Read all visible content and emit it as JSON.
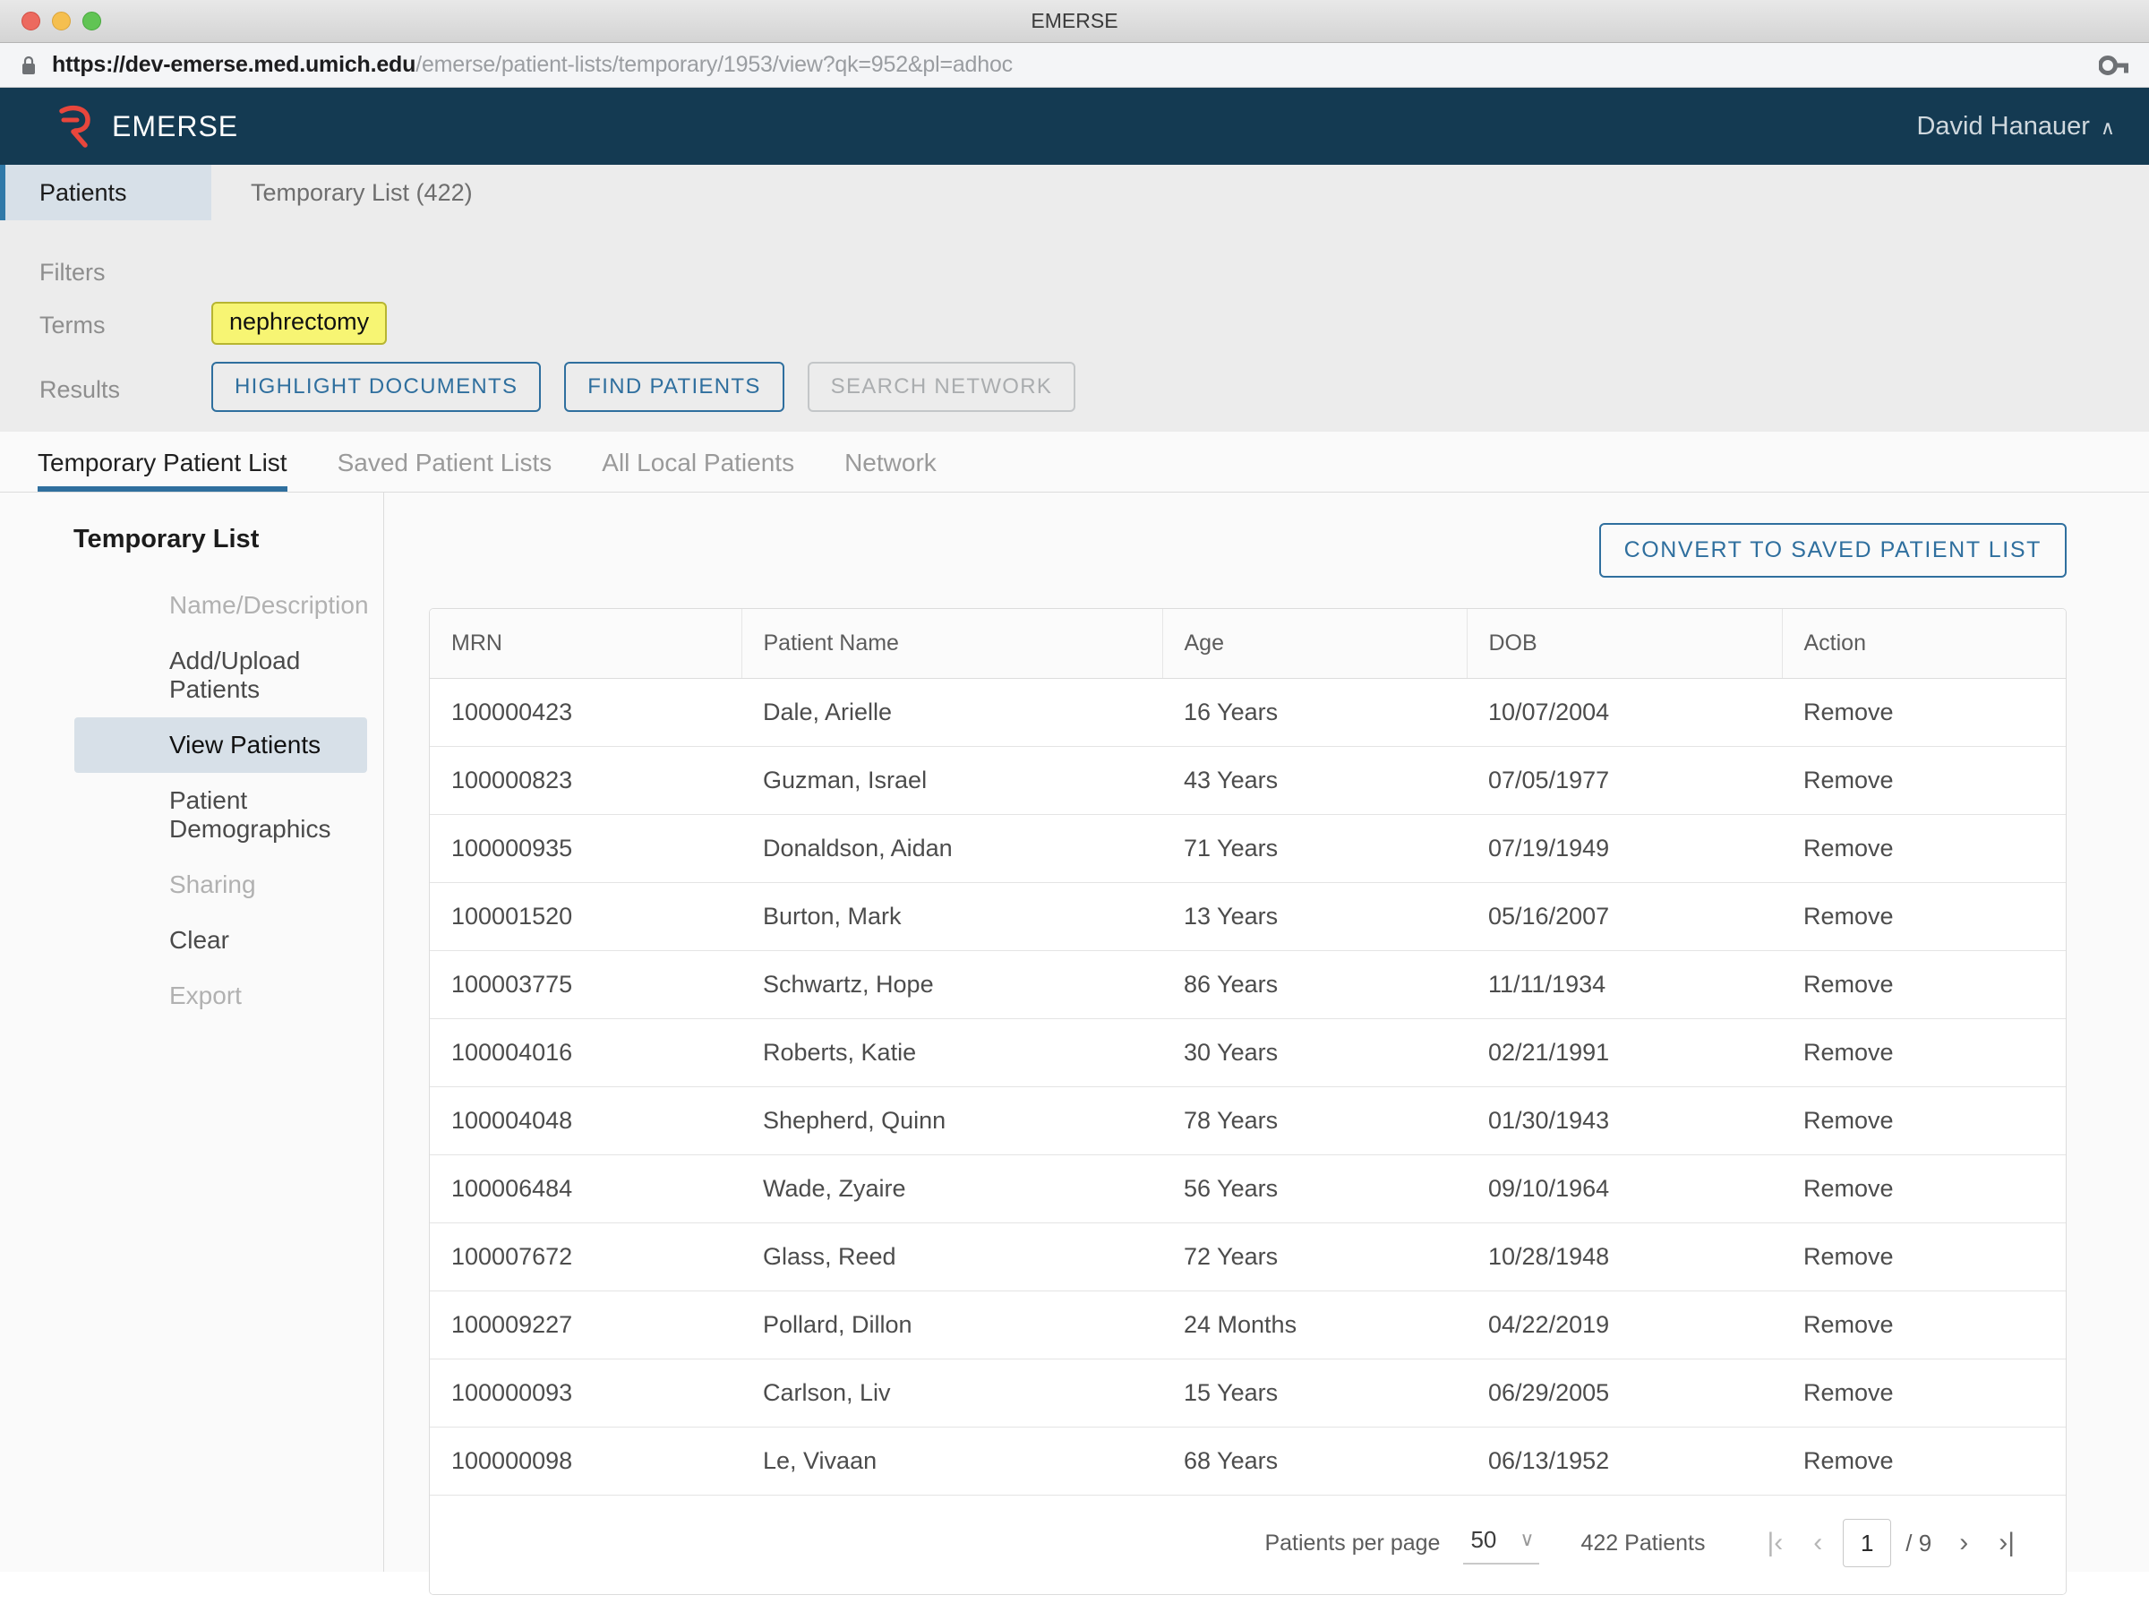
{
  "window": {
    "title": "EMERSE",
    "traffic_lights": [
      "close-red",
      "minimize-yellow",
      "maximize-green"
    ]
  },
  "browser": {
    "lock_icon": "lock-icon",
    "key_icon": "key-icon",
    "url_host": "https://dev-emerse.med.umich.edu",
    "url_path": "/emerse/patient-lists/temporary/1953/view?qk=952&pl=adhoc"
  },
  "header": {
    "logo_icon": "emerse-logo-icon",
    "brand": "EMERSE",
    "user_name": "David Hanauer",
    "chevron": "∧",
    "bg_color": "#143a52",
    "logo_color": "#e8463c"
  },
  "search_panel": {
    "rows": [
      {
        "label": "Patients",
        "active": true,
        "value": "Temporary List (422)"
      },
      {
        "label": "Filters",
        "active": false,
        "value": ""
      },
      {
        "label": "Terms",
        "active": false,
        "value": ""
      },
      {
        "label": "Results",
        "active": false,
        "value": ""
      }
    ],
    "list_summary": "Temporary List (422)",
    "term_chip": "nephrectomy",
    "term_chip_color": "#f7f573",
    "buttons": [
      {
        "label": "HIGHLIGHT DOCUMENTS",
        "disabled": false
      },
      {
        "label": "FIND PATIENTS",
        "disabled": false
      },
      {
        "label": "SEARCH NETWORK",
        "disabled": true
      }
    ]
  },
  "tabs": [
    {
      "label": "Temporary Patient List",
      "active": true
    },
    {
      "label": "Saved Patient Lists",
      "active": false
    },
    {
      "label": "All Local Patients",
      "active": false
    },
    {
      "label": "Network",
      "active": false
    }
  ],
  "sidebar": {
    "title": "Temporary List",
    "items": [
      {
        "label": "Name/Description",
        "state": "disabled"
      },
      {
        "label": "Add/Upload Patients",
        "state": "normal"
      },
      {
        "label": "View Patients",
        "state": "selected"
      },
      {
        "label": "Patient Demographics",
        "state": "normal"
      },
      {
        "label": "Sharing",
        "state": "disabled"
      },
      {
        "label": "Clear",
        "state": "normal"
      },
      {
        "label": "Export",
        "state": "disabled"
      }
    ]
  },
  "main": {
    "convert_button": "CONVERT TO SAVED PATIENT LIST",
    "accent_color": "#2f6f9e",
    "table": {
      "columns": [
        "MRN",
        "Patient Name",
        "Age",
        "DOB",
        "Action"
      ],
      "action_label": "Remove",
      "rows": [
        {
          "mrn": "100000423",
          "name": "Dale, Arielle",
          "age": "16 Years",
          "dob": "10/07/2004",
          "action": "Remove"
        },
        {
          "mrn": "100000823",
          "name": "Guzman, Israel",
          "age": "43 Years",
          "dob": "07/05/1977",
          "action": "Remove"
        },
        {
          "mrn": "100000935",
          "name": "Donaldson, Aidan",
          "age": "71 Years",
          "dob": "07/19/1949",
          "action": "Remove"
        },
        {
          "mrn": "100001520",
          "name": "Burton, Mark",
          "age": "13 Years",
          "dob": "05/16/2007",
          "action": "Remove"
        },
        {
          "mrn": "100003775",
          "name": "Schwartz, Hope",
          "age": "86 Years",
          "dob": "11/11/1934",
          "action": "Remove"
        },
        {
          "mrn": "100004016",
          "name": "Roberts, Katie",
          "age": "30 Years",
          "dob": "02/21/1991",
          "action": "Remove"
        },
        {
          "mrn": "100004048",
          "name": "Shepherd, Quinn",
          "age": "78 Years",
          "dob": "01/30/1943",
          "action": "Remove"
        },
        {
          "mrn": "100006484",
          "name": "Wade, Zyaire",
          "age": "56 Years",
          "dob": "09/10/1964",
          "action": "Remove"
        },
        {
          "mrn": "100007672",
          "name": "Glass, Reed",
          "age": "72 Years",
          "dob": "10/28/1948",
          "action": "Remove"
        },
        {
          "mrn": "100009227",
          "name": "Pollard, Dillon",
          "age": "24 Months",
          "dob": "04/22/2019",
          "action": "Remove"
        },
        {
          "mrn": "100000093",
          "name": "Carlson, Liv",
          "age": "15 Years",
          "dob": "06/29/2005",
          "action": "Remove"
        },
        {
          "mrn": "100000098",
          "name": "Le, Vivaan",
          "age": "68 Years",
          "dob": "06/13/1952",
          "action": "Remove"
        }
      ]
    },
    "pagination": {
      "per_page_label": "Patients per page",
      "per_page_value": "50",
      "per_page_chevron": "∨",
      "total_label": "422 Patients",
      "first_icon": "|‹",
      "prev_icon": "‹",
      "current_page": "1",
      "page_total": "/ 9",
      "next_icon": "›",
      "last_icon": "›|"
    }
  }
}
